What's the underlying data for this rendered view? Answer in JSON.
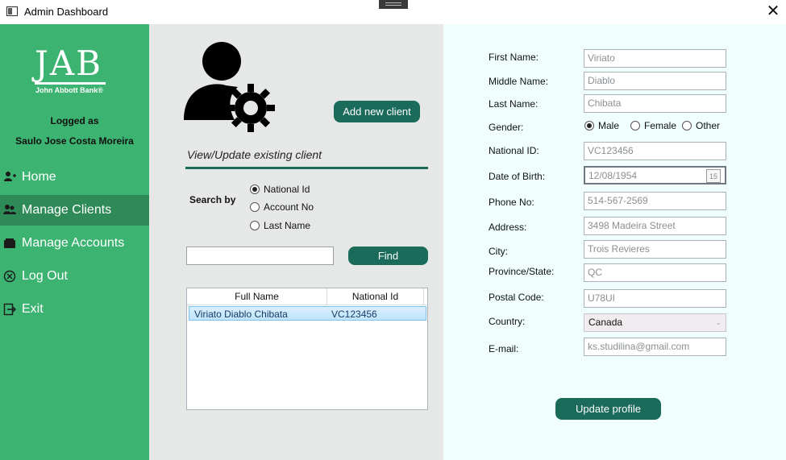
{
  "window": {
    "title": "Admin Dashboard"
  },
  "colors": {
    "sidebar": "#3cb371",
    "sidebar_active": "#2e8b57",
    "primary_button": "#1b6b5a",
    "middle_bg": "#e6e8e7",
    "right_bg": "#f0fefe"
  },
  "sidebar": {
    "logo": {
      "big": "JAB",
      "small": "John Abbott Bank®"
    },
    "logged_as": "Logged as",
    "user_name": "Saulo Jose Costa Moreira",
    "items": [
      {
        "label": "Home",
        "icon": "user-icon"
      },
      {
        "label": "Manage Clients",
        "icon": "users-icon",
        "active": true
      },
      {
        "label": "Manage Accounts",
        "icon": "wallet-icon"
      },
      {
        "label": "Log Out",
        "icon": "circle-x-icon"
      },
      {
        "label": "Exit",
        "icon": "exit-icon"
      }
    ]
  },
  "middle": {
    "add_client_label": "Add new client",
    "section_title": "View/Update existing client",
    "search_by_label": "Search by",
    "search_options": [
      {
        "label": "National Id",
        "checked": true
      },
      {
        "label": "Account No",
        "checked": false
      },
      {
        "label": "Last Name",
        "checked": false
      }
    ],
    "search_value": "",
    "find_label": "Find",
    "grid": {
      "columns": [
        "Full Name",
        "National Id"
      ],
      "rows": [
        {
          "full_name": "Viriato Diablo Chibata",
          "national_id": "VC123456"
        }
      ]
    }
  },
  "form": {
    "first_name": {
      "label": "First Name:",
      "value": "Viriato"
    },
    "middle_name": {
      "label": "Middle Name:",
      "value": "Diablo"
    },
    "last_name": {
      "label": "Last Name:",
      "value": "Chibata"
    },
    "gender": {
      "label": "Gender:",
      "options": [
        "Male",
        "Female",
        "Other"
      ],
      "selected": "Male"
    },
    "national_id": {
      "label": "National ID:",
      "value": "VC123456"
    },
    "dob": {
      "label": "Date of Birth:",
      "value": "12/08/1954",
      "icon_text": "15"
    },
    "phone": {
      "label": "Phone No:",
      "value": "514-567-2569"
    },
    "address": {
      "label": "Address:",
      "value": "3498 Madeira Street"
    },
    "city": {
      "label": "City:",
      "value": "Trois Revieres"
    },
    "province": {
      "label": "Province/State:",
      "value": "QC"
    },
    "postal": {
      "label": "Postal Code:",
      "value": "U78UI"
    },
    "country": {
      "label": "Country:",
      "value": "Canada"
    },
    "email": {
      "label": "E-mail:",
      "value": "ks.studilina@gmail.com"
    },
    "update_label": "Update profile"
  }
}
